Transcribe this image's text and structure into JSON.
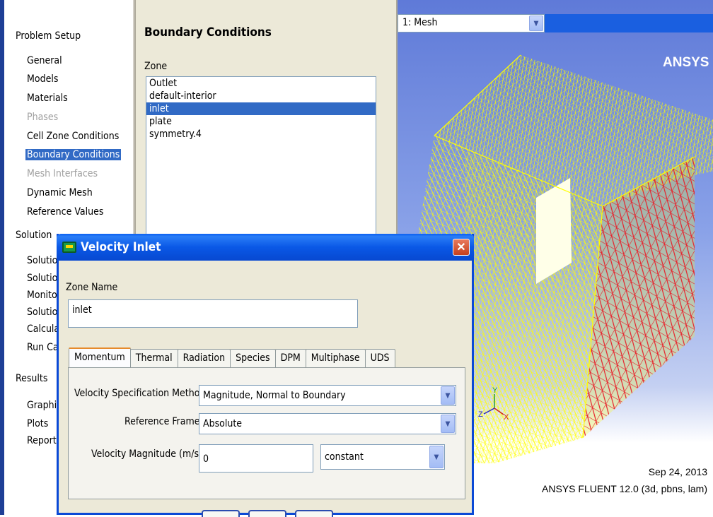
{
  "tree": {
    "problem_setup": "Problem Setup",
    "general": "General",
    "models": "Models",
    "materials": "Materials",
    "phases": "Phases",
    "cell_zone_conditions": "Cell Zone Conditions",
    "boundary_conditions": "Boundary Conditions",
    "mesh_interfaces": "Mesh Interfaces",
    "dynamic_mesh": "Dynamic Mesh",
    "reference_values": "Reference Values",
    "solution": "Solution",
    "solution_methods": "Solution",
    "solution_controls": "Solution",
    "monitors": "Monitor",
    "solution_init": "Solution",
    "calculation_activities": "Calcula",
    "run_calculation": "Run Ca",
    "results": "Results",
    "graphics": "Graphic",
    "plots": "Plots",
    "reports": "Reports"
  },
  "panel": {
    "title": "Boundary Conditions",
    "zone_label": "Zone",
    "zones": [
      "Outlet",
      "default-interior",
      "inlet",
      "plate",
      "symmetry.4"
    ],
    "selected_zone": "inlet"
  },
  "graphics": {
    "view_select": "1: Mesh",
    "logo": "ANSYS",
    "date": "Sep 24, 2013",
    "version": "ANSYS FLUENT 12.0 (3d, pbns, lam)",
    "axis_x": "X",
    "axis_y": "Y",
    "axis_z": "Z",
    "colors": {
      "mesh": "#ffff00",
      "inlet_mesh": "#e8202a",
      "bg_top": "#5f7ad8"
    }
  },
  "dialog": {
    "title": "Velocity Inlet",
    "zone_name_label": "Zone Name",
    "zone_name_value": "inlet",
    "tabs": [
      "Momentum",
      "Thermal",
      "Radiation",
      "Species",
      "DPM",
      "Multiphase",
      "UDS"
    ],
    "active_tab": "Momentum",
    "vel_spec_label": "Velocity Specification Method",
    "vel_spec_value": "Magnitude, Normal to Boundary",
    "ref_frame_label": "Reference Frame",
    "ref_frame_value": "Absolute",
    "vel_mag_label": "Velocity Magnitude (m/s)",
    "vel_mag_value": "0",
    "vel_mag_profile": "constant"
  }
}
